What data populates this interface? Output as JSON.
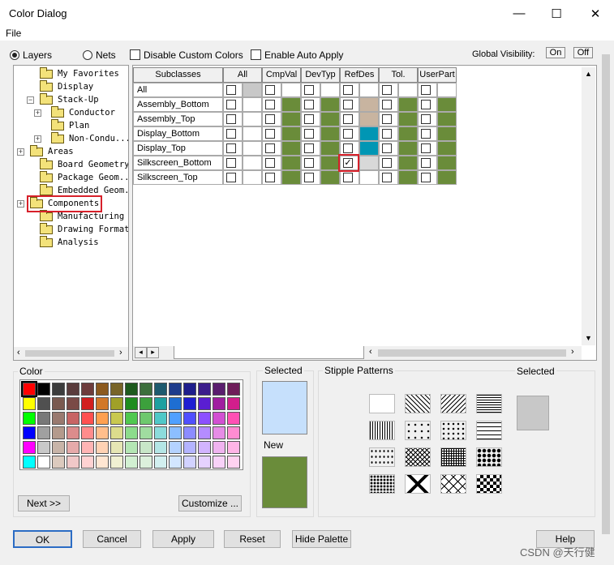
{
  "window": {
    "title": "Color Dialog",
    "min": "—",
    "max": "☐",
    "close": "✕"
  },
  "menu": {
    "file": "File"
  },
  "options": {
    "layers": "Layers",
    "nets": "Nets",
    "disable_custom": "Disable Custom Colors",
    "enable_auto_apply": "Enable Auto Apply",
    "global_visibility": "Global Visibility:",
    "on": "On",
    "off": "Off"
  },
  "tree": [
    {
      "label": "My Favorites"
    },
    {
      "label": "Display"
    },
    {
      "label": "Stack-Up"
    },
    {
      "label": "Conductor"
    },
    {
      "label": "Plan"
    },
    {
      "label": "Non-Condu..."
    },
    {
      "label": "Areas"
    },
    {
      "label": "Board Geometry"
    },
    {
      "label": "Package Geom..."
    },
    {
      "label": "Embedded Geom..."
    },
    {
      "label": "Components"
    },
    {
      "label": "Manufacturing"
    },
    {
      "label": "Drawing Format"
    },
    {
      "label": "Analysis"
    }
  ],
  "grid": {
    "header": "Subclasses",
    "columns": [
      "All",
      "CmpVal",
      "DevTyp",
      "RefDes",
      "Tol.",
      "UserPart"
    ],
    "rows": [
      "All",
      "Assembly_Bottom",
      "Assembly_Top",
      "Display_Bottom",
      "Display_Top",
      "Silkscreen_Bottom",
      "Silkscreen_Top"
    ],
    "checkmark": "✓"
  },
  "color": {
    "label": "Color",
    "selected": "Selected",
    "new": "New",
    "next": "Next >>",
    "customize": "Customize ...",
    "selected_color": "#c6e0fc",
    "new_color": "#6a8c3a"
  },
  "stipple": {
    "label": "Stipple Patterns",
    "selected": "Selected"
  },
  "buttons": {
    "ok": "OK",
    "cancel": "Cancel",
    "apply": "Apply",
    "reset": "Reset",
    "hide_palette": "Hide Palette",
    "help": "Help"
  },
  "watermark": "CSDN @天行健"
}
